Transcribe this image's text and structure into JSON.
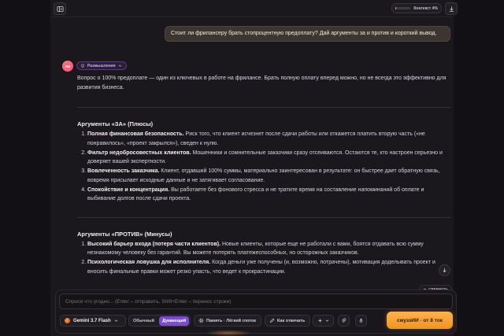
{
  "topbar": {
    "context_label": "Контекст 4%",
    "context_fraction": 0.04
  },
  "user_message": "Стоит ли фрилансеру брать стопроцентную предоплату? Дай аргументы за и против и короткий вывод.",
  "assistant": {
    "avatar_label": "ИИ",
    "thinking_label": "Размышления",
    "intro": "Вопрос о 100% предоплате — один из ключевых в работе на фрилансе. Брать полную оплату вперед можно, но не всегда это эффективно для развития бизнеса.",
    "pros_heading": "Аргументы «ЗА» (Плюсы)",
    "pros": [
      {
        "title": "Полная финансовая безопасность.",
        "text": " Риск того, что клиент исчезнет после сдачи работы или откажется платить вторую часть («не понравилось», «проект закрылся»), сведен к нулю."
      },
      {
        "title": "Фильтр недобросовестных клиентов.",
        "text": " Мошенники и сомнительные заказчики сразу отсеиваются. Остаются те, кто настроен серьезно и доверяет вашей экспертности."
      },
      {
        "title": "Вовлеченность заказчика.",
        "text": " Клиент, отдавший 100% суммы, материально заинтересован в результате: он быстрее дает обратную связь, вовремя присылает исходные данные и не затягивает согласование."
      },
      {
        "title": "Спокойствие и концентрация.",
        "text": " Вы работаете без фонового стресса и не тратите время на составление напоминаний об оплате и выбивание долгов после сдачи проекта."
      }
    ],
    "cons_heading": "Аргументы «ПРОТИВ» (Минусы)",
    "cons": [
      {
        "title": "Высокий барьер входа (потеря части клиентов).",
        "text": " Новые клиенты, которые еще не работали с вами, боятся отдавать всю сумму незнакомому человеку без гарантий. Вы можете потерять платежеспособных, но осторожных заказчиков."
      },
      {
        "title": "Психологическая ловушка для исполнителя.",
        "text": " Когда деньги уже получены (и, возможно, потрачены), мотивация доделывать проект и вносить финальные правки может резко упасть, что ведет к прокрастинации."
      }
    ]
  },
  "collapse_label": "СВЕРНУТЬ",
  "composer": {
    "placeholder": "Спроси что угодно... (Enter – отправить, Shift+Enter – перенос строки)",
    "model": "Gemini 3.7 Flash",
    "mode_normal": "Обычный",
    "mode_thinking": "Думающий",
    "memory": "Память · Лёгкий глоток",
    "answer_style": "Как отвечать",
    "send": "смуззИИ · от 8 ток"
  },
  "colors": {
    "accent_orange": "#f5a83a",
    "accent_purple": "#7b4bd6"
  }
}
